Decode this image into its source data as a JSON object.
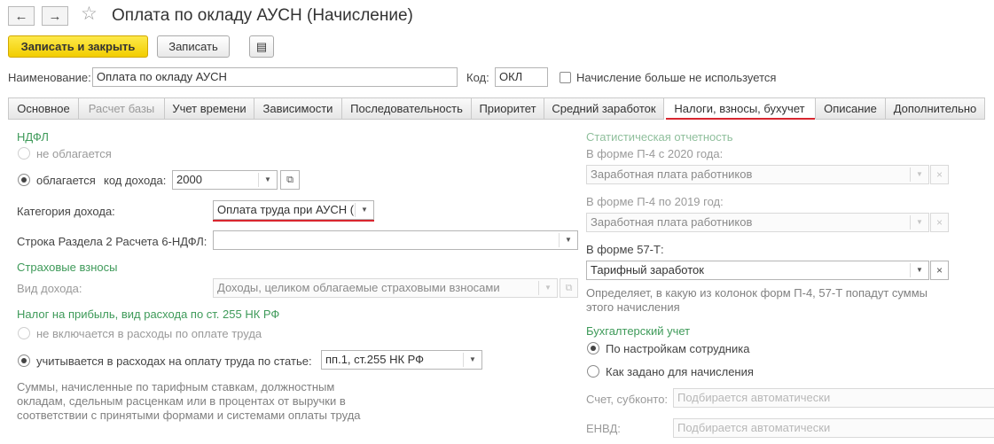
{
  "window": {
    "title": "Оплата по окладу АУСН (Начисление)",
    "back_icon": "←",
    "forward_icon": "→",
    "star_icon": "☆"
  },
  "toolbar": {
    "save_close_label": "Записать и закрыть",
    "save_label": "Записать",
    "report_icon": "▤"
  },
  "header_fields": {
    "name_label": "Наименование:",
    "name_value": "Оплата по окладу АУСН",
    "code_label": "Код:",
    "code_value": "ОКЛ",
    "unused_label": "Начисление больше не используется"
  },
  "tabs": [
    {
      "label": "Основное"
    },
    {
      "label": "Расчет базы"
    },
    {
      "label": "Учет времени"
    },
    {
      "label": "Зависимости"
    },
    {
      "label": "Последовательность"
    },
    {
      "label": "Приоритет"
    },
    {
      "label": "Средний заработок"
    },
    {
      "label": "Налоги, взносы, бухучет"
    },
    {
      "label": "Описание"
    },
    {
      "label": "Дополнительно"
    }
  ],
  "ndfl": {
    "section": "НДФЛ",
    "not_taxed": "не облагается",
    "taxed": "облагается",
    "income_code_label": "код дохода:",
    "income_code_value": "2000",
    "category_label": "Категория дохода:",
    "category_value": "Оплата труда при АУСН (",
    "line6_label": "Строка Раздела 2 Расчета 6-НДФЛ:",
    "line6_value": ""
  },
  "insurance": {
    "section": "Страховые взносы",
    "income_type_label": "Вид дохода:",
    "income_type_value": "Доходы, целиком облагаемые страховыми взносами"
  },
  "profit_tax": {
    "section": "Налог на прибыль, вид расхода по ст. 255 НК РФ",
    "not_included": "не включается в расходы по оплате труда",
    "included": "учитывается в расходах на оплату труда по статье:",
    "article_value": "пп.1, ст.255 НК РФ",
    "note": "Суммы, начисленные по тарифным ставкам, должностным окладам, сдельным расценкам или в процентах от выручки в соответствии с принятыми формами и системами оплаты труда"
  },
  "stats": {
    "section": "Статистическая отчетность",
    "p4_2020_label": "В форме П-4 с 2020 года:",
    "p4_2020_value": "Заработная плата работников",
    "p4_2019_label": "В форме П-4 по 2019 год:",
    "p4_2019_value": "Заработная плата работников",
    "f57_label": "В форме 57-Т:",
    "f57_value": "Тарифный заработок",
    "note": "Определяет, в какую из колонок форм П-4, 57-Т попадут суммы этого начисления"
  },
  "accounting": {
    "section": "Бухгалтерский учет",
    "by_employee": "По настройкам сотрудника",
    "as_set": "Как задано для начисления",
    "account_label": "Счет, субконто:",
    "account_placeholder": "Подбирается автоматически",
    "envd_label": "ЕНВД:",
    "envd_placeholder": "Подбирается автоматически"
  },
  "icons": {
    "dropdown": "▼",
    "clear": "×",
    "open": "⧉"
  }
}
